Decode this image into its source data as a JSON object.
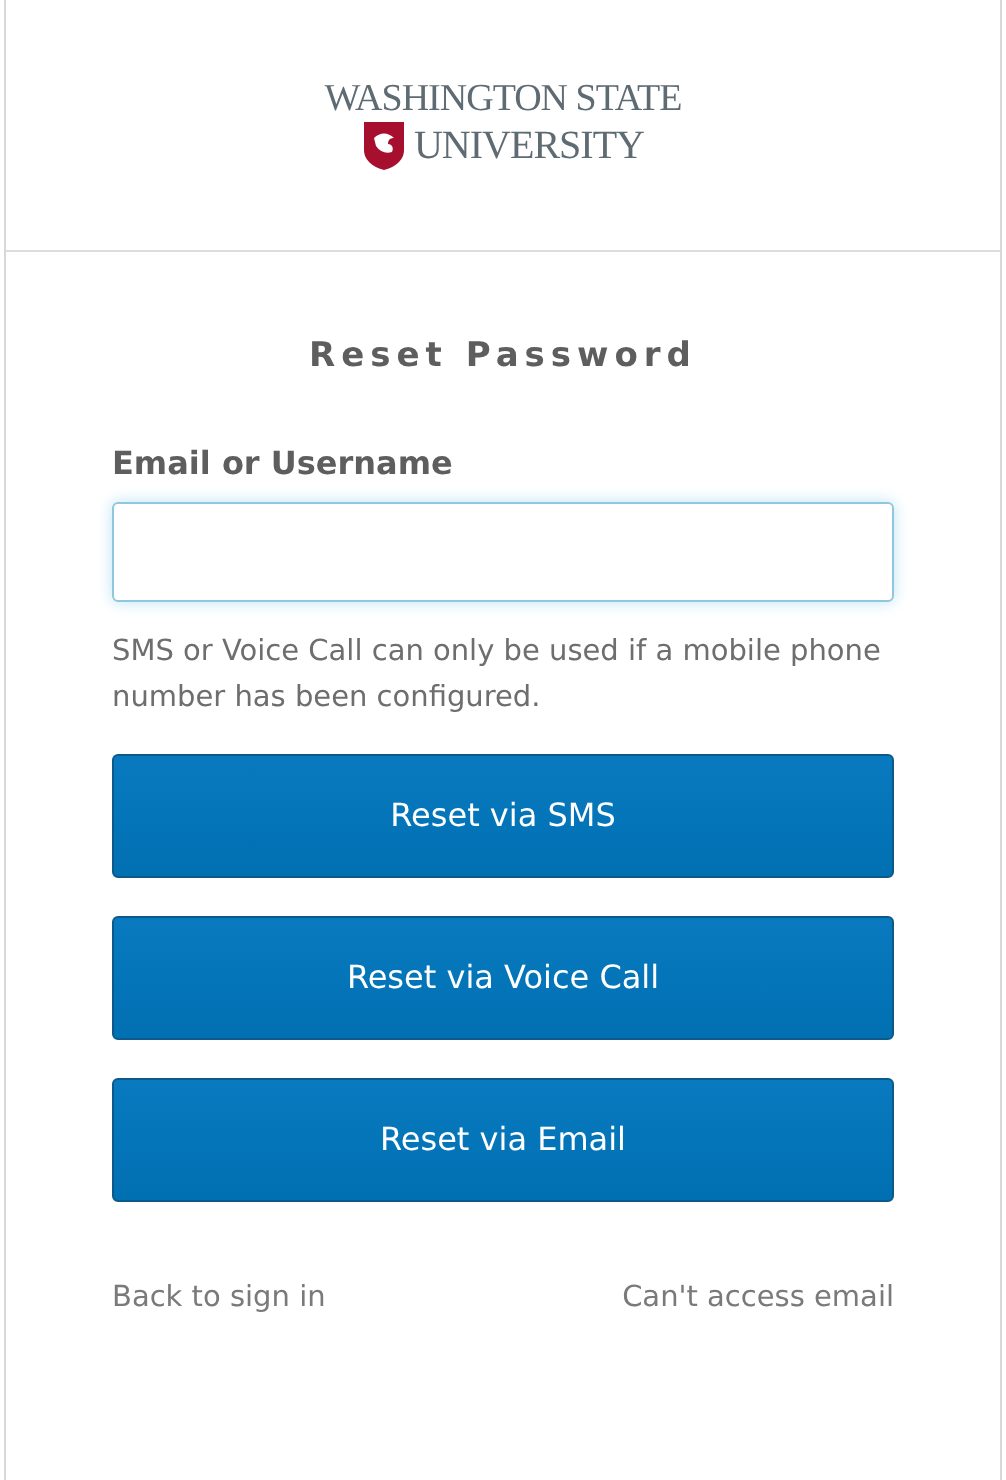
{
  "logo": {
    "line_1": "WASHINGTON STATE",
    "line_2": "UNIVERSITY"
  },
  "title": "Reset Password",
  "field": {
    "label": "Email or Username",
    "focused": true
  },
  "hint": "SMS or Voice Call can only be used if a mobile phone number has been configured.",
  "buttons": [
    "Reset via SMS",
    "Reset via Voice Call",
    "Reset via Email"
  ],
  "links": [
    "Back to sign in",
    "Can't access email"
  ]
}
